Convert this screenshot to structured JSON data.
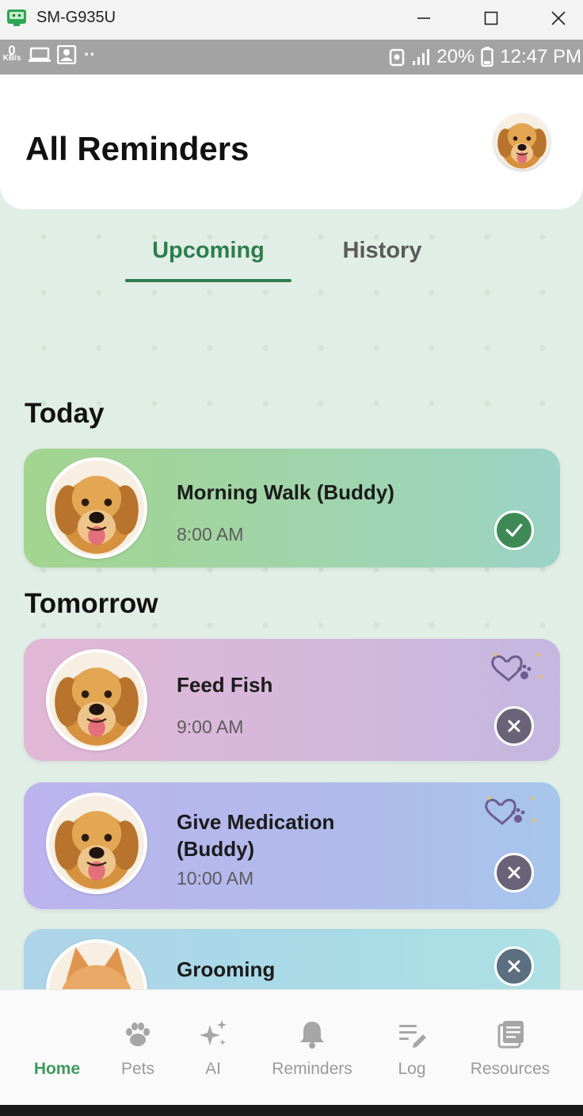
{
  "window": {
    "title": "SM-G935U",
    "min_glyph": "—",
    "max_glyph": "☐",
    "close_glyph": "✕"
  },
  "status_bar": {
    "speed_value": "0",
    "speed_unit": "KB/s",
    "dots": "··",
    "battery_percent": "20%",
    "time": "12:47 PM"
  },
  "header": {
    "title": "All Reminders",
    "avatar_icon": "golden-retriever-photo"
  },
  "tabs": [
    {
      "label": "Upcoming",
      "active": true
    },
    {
      "label": "History",
      "active": false
    }
  ],
  "sections": {
    "today": "Today",
    "tomorrow": "Tomorrow"
  },
  "reminders": [
    {
      "title": "Morning Walk (Buddy)",
      "time": "8:00 AM",
      "status": "completed",
      "pet": "dog"
    },
    {
      "title": "Feed Fish",
      "time": "9:00 AM",
      "status": "cancel",
      "pet": "dog"
    },
    {
      "title_line1": "Give Medication",
      "title_line2": "(Buddy)",
      "time": "10:00 AM",
      "status": "cancel",
      "pet": "dog"
    },
    {
      "title": "Grooming",
      "status": "cancel",
      "pet": "cat"
    }
  ],
  "nav": [
    {
      "label": "Home",
      "icon": "home",
      "active": true
    },
    {
      "label": "Pets",
      "icon": "paw-icon"
    },
    {
      "label": "AI",
      "icon": "sparkles-icon"
    },
    {
      "label": "Reminders",
      "icon": "bell-icon"
    },
    {
      "label": "Log",
      "icon": "edit-list-icon"
    },
    {
      "label": "Resources",
      "icon": "book-icon"
    }
  ],
  "colors": {
    "accent_green": "#2e7d4f",
    "app_background": "#e1eee6",
    "done_badge": "#3e8a57"
  }
}
